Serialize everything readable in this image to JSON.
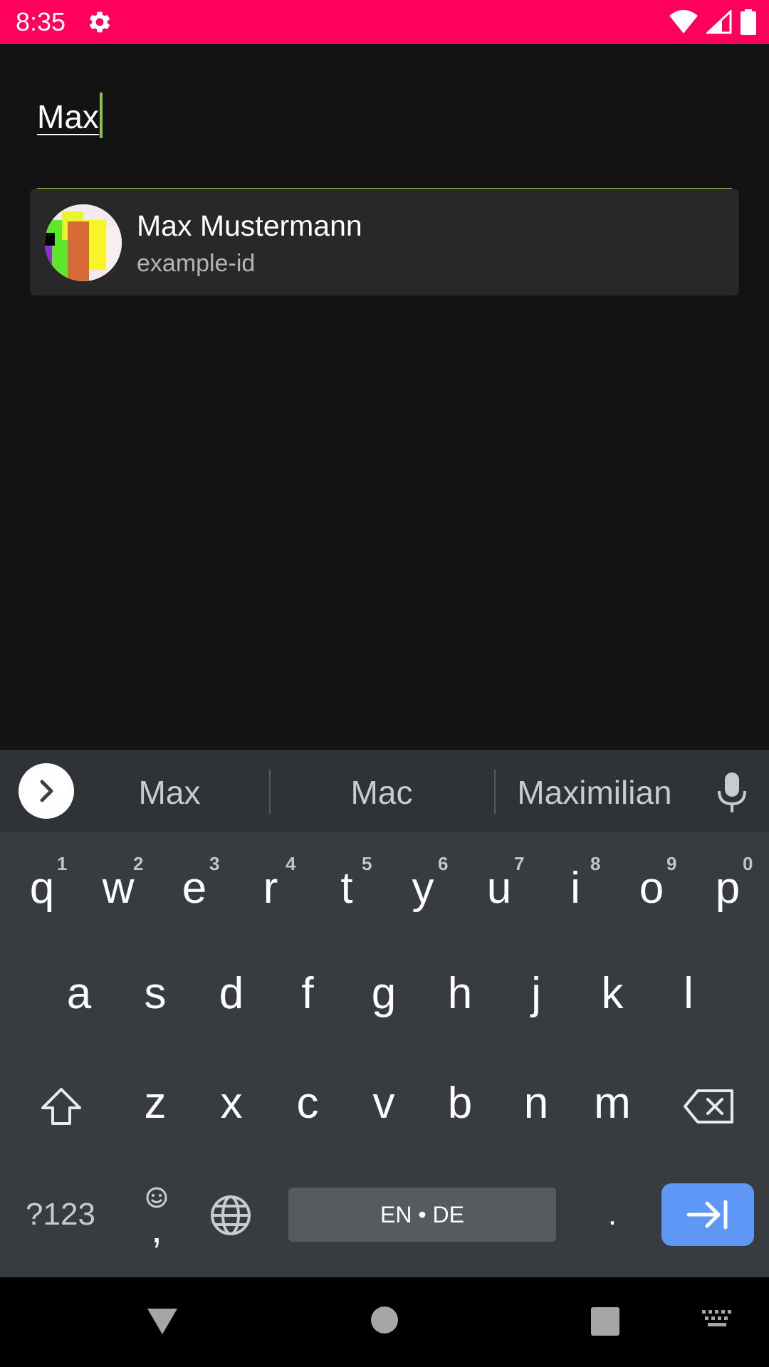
{
  "status_bar": {
    "time": "8:35",
    "color": "#ff005c",
    "icons": [
      "settings-gear-icon",
      "wifi-icon",
      "cellular-signal-icon",
      "battery-icon"
    ]
  },
  "search": {
    "value": "Max",
    "accent_color": "#8bc34a"
  },
  "results": [
    {
      "name": "Max Mustermann",
      "id": "example-id"
    }
  ],
  "keyboard": {
    "suggestions": [
      "Max",
      "Mac",
      "Maximilian"
    ],
    "row1": [
      {
        "label": "q",
        "hint": "1"
      },
      {
        "label": "w",
        "hint": "2"
      },
      {
        "label": "e",
        "hint": "3"
      },
      {
        "label": "r",
        "hint": "4"
      },
      {
        "label": "t",
        "hint": "5"
      },
      {
        "label": "y",
        "hint": "6"
      },
      {
        "label": "u",
        "hint": "7"
      },
      {
        "label": "i",
        "hint": "8"
      },
      {
        "label": "o",
        "hint": "9"
      },
      {
        "label": "p",
        "hint": "0"
      }
    ],
    "row2": [
      "a",
      "s",
      "d",
      "f",
      "g",
      "h",
      "j",
      "k",
      "l"
    ],
    "row3": [
      "z",
      "x",
      "c",
      "v",
      "b",
      "n",
      "m"
    ],
    "symbols_label": "?123",
    "comma_label": ",",
    "space_label": "EN • DE",
    "period_label": ".",
    "enter_color": "#5e97f6"
  },
  "nav_bar": {
    "icons": [
      "back-icon",
      "home-icon",
      "recents-icon",
      "keyboard-switch-icon"
    ]
  }
}
